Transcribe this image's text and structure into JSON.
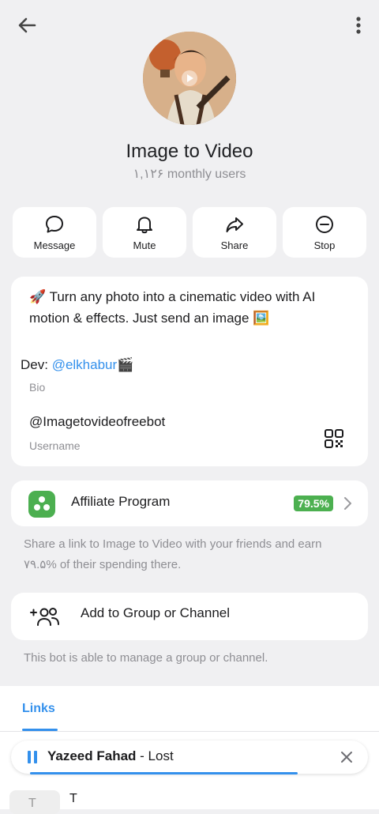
{
  "profile": {
    "title": "Image to Video",
    "subtitle": "۱,۱۲۶ monthly users"
  },
  "actions": [
    {
      "label": "Message",
      "icon": "message-icon"
    },
    {
      "label": "Mute",
      "icon": "bell-icon"
    },
    {
      "label": "Share",
      "icon": "share-icon"
    },
    {
      "label": "Stop",
      "icon": "stop-icon"
    }
  ],
  "bio": {
    "text": "🚀 Turn any photo into a cinematic video with AI motion & effects. Just send an image 🖼️",
    "dev_prefix": "Dev: ",
    "dev_link": "@elkhabur",
    "dev_emoji": "🎬",
    "label": "Bio"
  },
  "username": {
    "value": "@Imagetovideofreebot",
    "label": "Username"
  },
  "affiliate": {
    "label": "Affiliate Program",
    "badge": "79.5%",
    "desc": "Share a link to Image to Video with your friends and earn ۷۹.۵% of their spending there."
  },
  "group": {
    "label": "Add to Group or Channel",
    "desc": "This bot is able to manage a group or channel."
  },
  "tabs": {
    "links": "Links"
  },
  "player": {
    "artist": "Yazeed Fahad",
    "separator": " - ",
    "track": "Lost",
    "progress": 0.75
  },
  "list": {
    "initial": "T",
    "title": "T"
  },
  "colors": {
    "accent": "#3390ec",
    "affiliate_green": "#4caf50"
  }
}
